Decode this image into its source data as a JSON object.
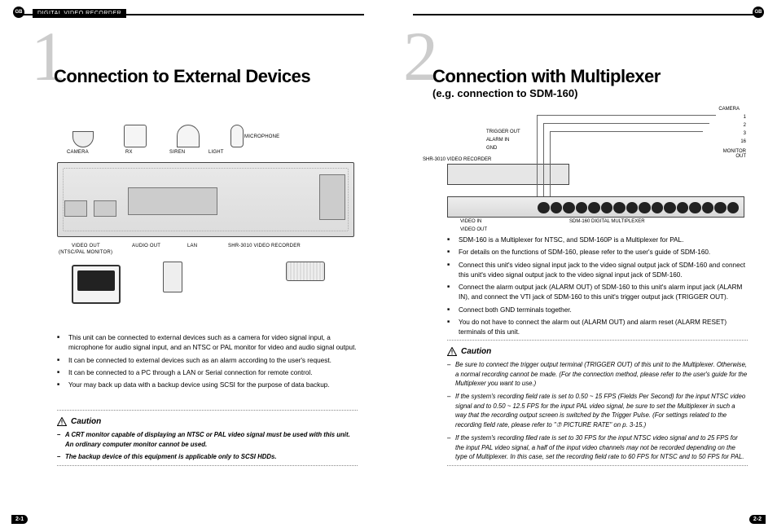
{
  "header": {
    "band": "DIGITAL VIDEO RECORDER",
    "gb": "GB"
  },
  "left": {
    "num": "1",
    "title": "Connection to External Devices",
    "diagram": {
      "camera": "CAMERA",
      "rx": "RX",
      "siren": "SIREN",
      "light": "LIGHT",
      "mic": "MICROPHONE",
      "video_out": "VIDEO OUT",
      "video_out_sub": "(NTSC/PAL MONITOR)",
      "audio_out": "AUDIO OUT",
      "lan": "LAN",
      "recorder": "SHR-3010 VIDEO RECORDER"
    },
    "bullets": [
      "This unit can be connected to external devices such as a camera for video signal input, a microphone for audio signal input, and an NTSC or PAL monitor for video and audio signal output.",
      "It can be connected to external devices such as an alarm according to the user's request.",
      "It can be connected to a PC through a LAN or Serial connection for remote control.",
      "Your may back up data with a backup device using SCSI for the purpose of data backup."
    ],
    "caution_title": "Caution",
    "caution": [
      "A CRT monitor capable of displaying an NTSC or PAL video signal must be used with this unit. An ordinary computer monitor cannot be used.",
      "The backup device of this equipment is applicable only to SCSI HDDs."
    ],
    "pagenum": "2-1"
  },
  "right": {
    "num": "2",
    "title": "Connection with Multiplexer",
    "subtitle": "(e.g. connection to SDM-160)",
    "diagram": {
      "camera": "CAMERA",
      "cam_nums": [
        "1",
        "2",
        "3",
        "16"
      ],
      "monitor_out": "MONITOR OUT",
      "trigger_out": "TRIGGER OUT",
      "alarm_in": "ALARM IN",
      "gnd": "GND",
      "recorder": "SHR-3010 VIDEO RECORDER",
      "mux": "SDM-160 DIGITAL MULTIPLEXER",
      "video_in": "VIDEO IN",
      "video_out": "VIDEO OUT"
    },
    "bullets": [
      "SDM-160 is a Multiplexer for NTSC, and SDM-160P is a Multiplexer for PAL.",
      "For details on the functions of SDM-160, please refer to the user's guide of SDM-160.",
      "Connect this unit's video signal input jack to the video signal output jack of SDM-160 and connect this unit's video signal output jack to the video signal input jack of SDM-160.",
      "Connect the alarm output jack (ALARM OUT) of SDM-160 to this unit's alarm input jack (ALARM IN), and connect the VTI jack of SDM-160 to this unit's trigger output jack (TRIGGER OUT).",
      "Connect both GND terminals together.",
      "You do not have to connect the alarm out (ALARM OUT) and alarm reset (ALARM RESET) terminals of this unit."
    ],
    "caution_title": "Caution",
    "caution": [
      "Be sure to connect the trigger output terminal (TRIGGER OUT) of this unit to the Multiplexer. Otherwise, a normal recording cannot be made. (For the connection method, please refer to the user's guide for the Multiplexer you want to use.)",
      "If the system's recording field rate is set to 0.50 ~ 15 FPS (Fields Per Second) for the input NTSC video signal and to 0.50 ~ 12.5 FPS for the input PAL video signal, be sure to set the Multiplexer in such a way that the recording output screen is switched by the Trigger Pulse. (For settings related to the recording field rate, please refer to \"⑦ PICTURE RATE\" on p. 3-15.)",
      "If the system's recording filed rate is set to 30 FPS for the input NTSC video signal and to 25 FPS for the input PAL video signal, a half of the input video channels may not be recorded depending on the type of Multiplexer. In this case, set the recording field rate to 60 FPS for NTSC and to 50 FPS for PAL."
    ],
    "pagenum": "2-2"
  }
}
